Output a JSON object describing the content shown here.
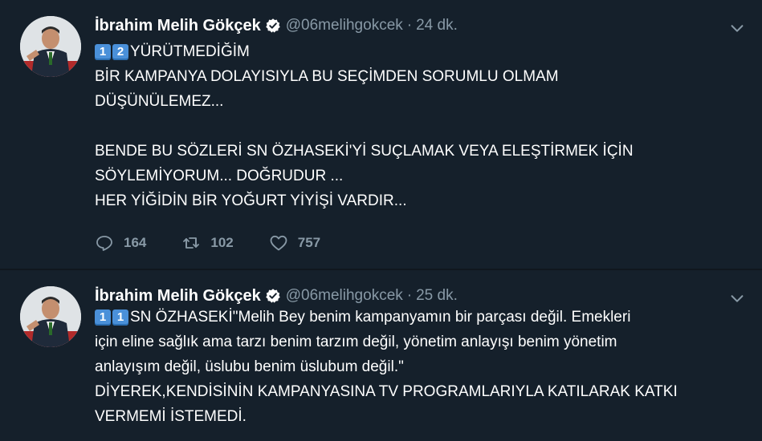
{
  "tweets": [
    {
      "author": {
        "name": "İbrahim Melih Gökçek",
        "handle": "@06melihgokcek"
      },
      "time": "24 dk.",
      "separator": "·",
      "emoji": [
        "1",
        "2"
      ],
      "lines": [
        "YÜRÜTMEDİĞİM",
        "BİR KAMPANYA DOLAYISIYLA BU SEÇİMDEN SORUMLU OLMAM",
        "DÜŞÜNÜLEMEZ...",
        "",
        "BENDE BU SÖZLERİ SN ÖZHASEKİ'Yİ SUÇLAMAK VEYA ELEŞTİRMEK İÇİN",
        "SÖYLEMİYORUM... DOĞRUDUR ...",
        "HER YİĞİDİN BİR YOĞURT YİYİŞİ VARDIR..."
      ],
      "actions": {
        "replies": "164",
        "retweets": "102",
        "likes": "757"
      }
    },
    {
      "author": {
        "name": "İbrahim Melih Gökçek",
        "handle": "@06melihgokcek"
      },
      "time": "25 dk.",
      "separator": "·",
      "emoji": [
        "1",
        "1"
      ],
      "lines": [
        "SN ÖZHASEKİ\"Melih Bey benim kampanyamın bir parçası değil. Emekleri",
        "için eline sağlık ama tarzı benim tarzım değil, yönetim anlayışı benim yönetim",
        "anlayışım değil, üslubu benim üslubum değil.\"",
        "DİYEREK,KENDİSİNİN KAMPANYASINA TV PROGRAMLARIYLA KATILARAK KATKI",
        "VERMEMİ İSTEMEDİ."
      ]
    }
  ],
  "colors": {
    "background": "#15202b",
    "muted": "#8899a6",
    "accent": "#1da1f2",
    "keycap": "#4a90d9"
  },
  "icons": [
    "verified-badge-icon",
    "chevron-down-icon",
    "reply-icon",
    "retweet-icon",
    "like-icon"
  ]
}
